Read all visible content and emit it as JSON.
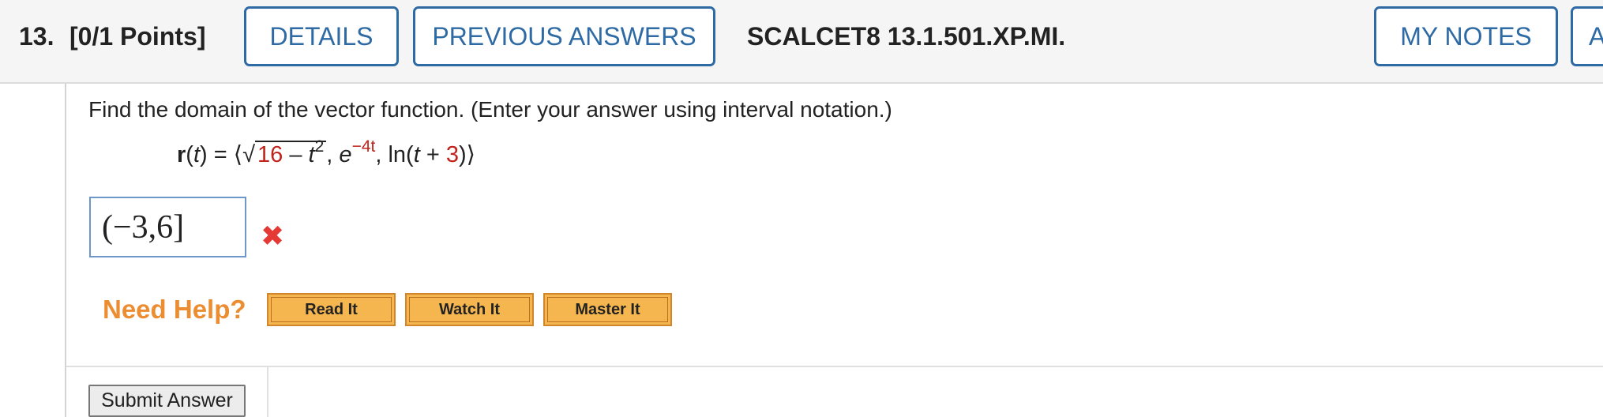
{
  "header": {
    "question_number": "13.",
    "points": "[0/1 Points]",
    "details_label": "DETAILS",
    "previous_answers_label": "PREVIOUS ANSWERS",
    "problem_code": "SCALCET8 13.1.501.XP.MI.",
    "my_notes_label": "MY NOTES",
    "next_button_partial": "A"
  },
  "question": {
    "prompt": "Find the domain of the vector function. (Enter your answer using interval notation.)",
    "formula": {
      "r": "r",
      "t": "t",
      "open": "(",
      "close": ")",
      "equals": "=",
      "angle_open": "⟨",
      "angle_close": "⟩",
      "sqrt_symbol": "√",
      "sqrt_const": "16",
      "minus": "–",
      "t_squared_exp": "2",
      "comma": ",",
      "e": "e",
      "exp": "−4t",
      "ln": "ln",
      "plus": "+",
      "three": "3"
    }
  },
  "answer": {
    "value": "(−3,6]",
    "status": "incorrect"
  },
  "help": {
    "need_help_label": "Need Help?",
    "read_it_label": "Read It",
    "watch_it_label": "Watch It",
    "master_it_label": "Master It"
  },
  "footer": {
    "submit_label": "Submit Answer"
  },
  "colors": {
    "accent_blue": "#2e6aa3",
    "help_orange": "#ec8d31",
    "button_orange": "#f6b64f",
    "error_red": "#e53935",
    "formula_red": "#c0231b"
  }
}
